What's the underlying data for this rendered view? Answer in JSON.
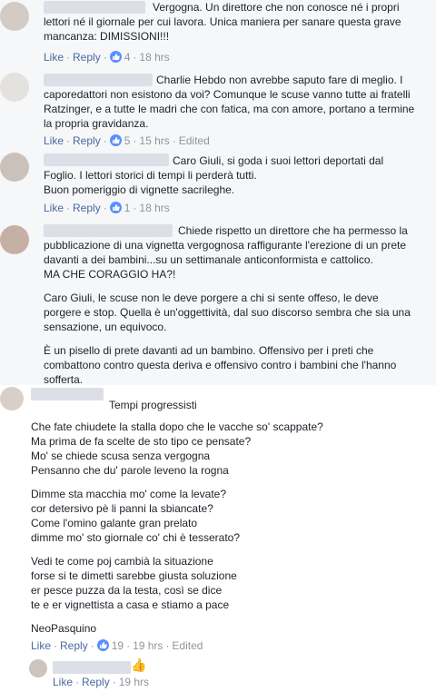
{
  "comments": [
    {
      "text": "Vergogna. Un direttore che non conosce né i propri\nlettori né il giornale per cui lavora. Unica maniera per sanare questa grave\nmancanza: DIMISSIONI!!!",
      "like_label": "Like",
      "reply_label": "Reply",
      "reactions": "4",
      "time": "18 hrs",
      "edited": ""
    },
    {
      "text": "Charlie Hebdo non avrebbe saputo fare di meglio. I\ncaporedattori non esistono da voi? Comunque le scuse vanno tutte ai fratelli\nRatzinger, e a tutte le madri che con fatica, ma con amore, portano a termine\nla propria gravidanza.",
      "like_label": "Like",
      "reply_label": "Reply",
      "reactions": "5",
      "time": "15 hrs",
      "edited": "Edited"
    },
    {
      "text": "Caro Giuli, si goda i suoi lettori deportati dal\nFoglio. I lettori storici di tempi li perderà tutti.\nBuon pomeriggio di vignette sacrileghe.",
      "like_label": "Like",
      "reply_label": "Reply",
      "reactions": "1",
      "time": "18 hrs",
      "edited": ""
    },
    {
      "paragraphs": [
        "Chiede rispetto un direttore che ha permesso la\npubblicazione di una vignetta vergognosa raffigurante l'erezione di un prete\ndavanti a dei bambini...su un settimanale anticonformista e cattolico.\nMA CHE CORAGGIO HA?!",
        "Caro Giuli, le scuse non le deve porgere a chi si sente offeso, le deve\nporgere e stop. Quella è un'oggettività, dal suo discorso sembra che sia una\nsensazione, un equivoco.",
        "È un pisello di prete davanti ad un bambino. Offensivo per i preti che\ncombattono contro questa deriva e offensivo contro i bambini che l'hanno\nsofferta."
      ]
    },
    {
      "paragraphs": [
        "Tempi progressisti",
        "Che fate chiudete la stalla dopo che le vacche so' scappate?\nMa prima de fa scelte de sto tipo ce pensate?\nMo' se chiede scusa senza vergogna\nPensanno che du' parole leveno la rogna",
        "Dimme sta macchia mo' come la levate?\ncor detersivo pè li panni la sbiancate?\nCome l'omino galante gran prelato\ndimme mo' sto giornale co' chi è tesserato?",
        "Vedi te come poj cambià la situazione\nforse si te dimetti sarebbe giusta soluzione\ner pesce puzza da la testa, così se dice\nte e er vignettista a casa e stiamo a pace",
        "NeoPasquino"
      ],
      "like_label": "Like",
      "reply_label": "Reply",
      "reactions": "19",
      "time": "19 hrs",
      "edited": "Edited"
    }
  ],
  "reply": {
    "like_label": "Like",
    "reply_label": "Reply",
    "time": "19 hrs"
  },
  "colors": {
    "link": "#4b67a1",
    "meta": "#90949c",
    "like_badge": "#5890ff",
    "panel_bg": "#f6f7f9"
  }
}
